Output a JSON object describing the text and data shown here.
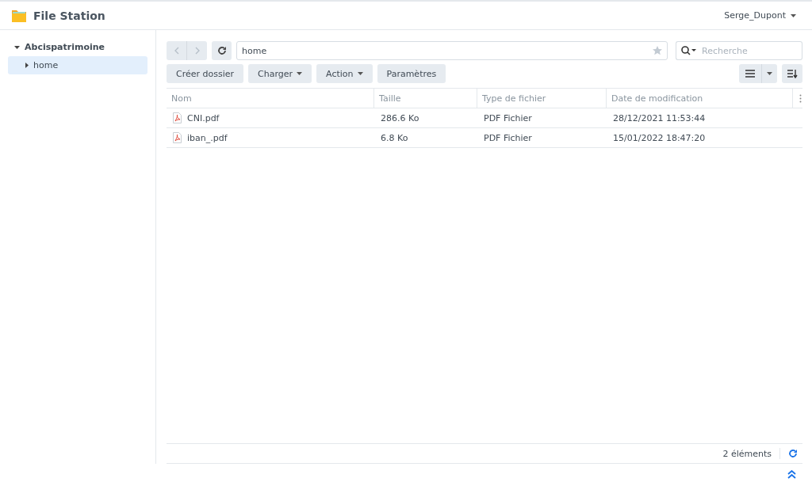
{
  "window": {
    "title": "File Station",
    "user": "Serge_Dupont"
  },
  "sidebar": {
    "tree": [
      {
        "label": "Abcispatrimoine",
        "expanded": true,
        "selected": false,
        "children": [
          {
            "label": "home",
            "expanded": false,
            "selected": true
          }
        ]
      }
    ]
  },
  "path": {
    "value": "home"
  },
  "search": {
    "placeholder": "Recherche"
  },
  "toolbar": [
    {
      "label": "Créer dossier",
      "dropdown": false
    },
    {
      "label": "Charger",
      "dropdown": true
    },
    {
      "label": "Action",
      "dropdown": true
    },
    {
      "label": "Paramètres",
      "dropdown": false
    }
  ],
  "table": {
    "columns": [
      "Nom",
      "Taille",
      "Type de fichier",
      "Date de modification"
    ],
    "rows": [
      {
        "cells": [
          "CNI.pdf",
          "286.6 Ko",
          "PDF Fichier",
          "28/12/2021 11:53:44"
        ]
      },
      {
        "cells": [
          "iban_.pdf",
          "6.8 Ko",
          "PDF Fichier",
          "15/01/2022 18:47:20"
        ]
      }
    ]
  },
  "status_bar": {
    "count": "2 éléments"
  }
}
